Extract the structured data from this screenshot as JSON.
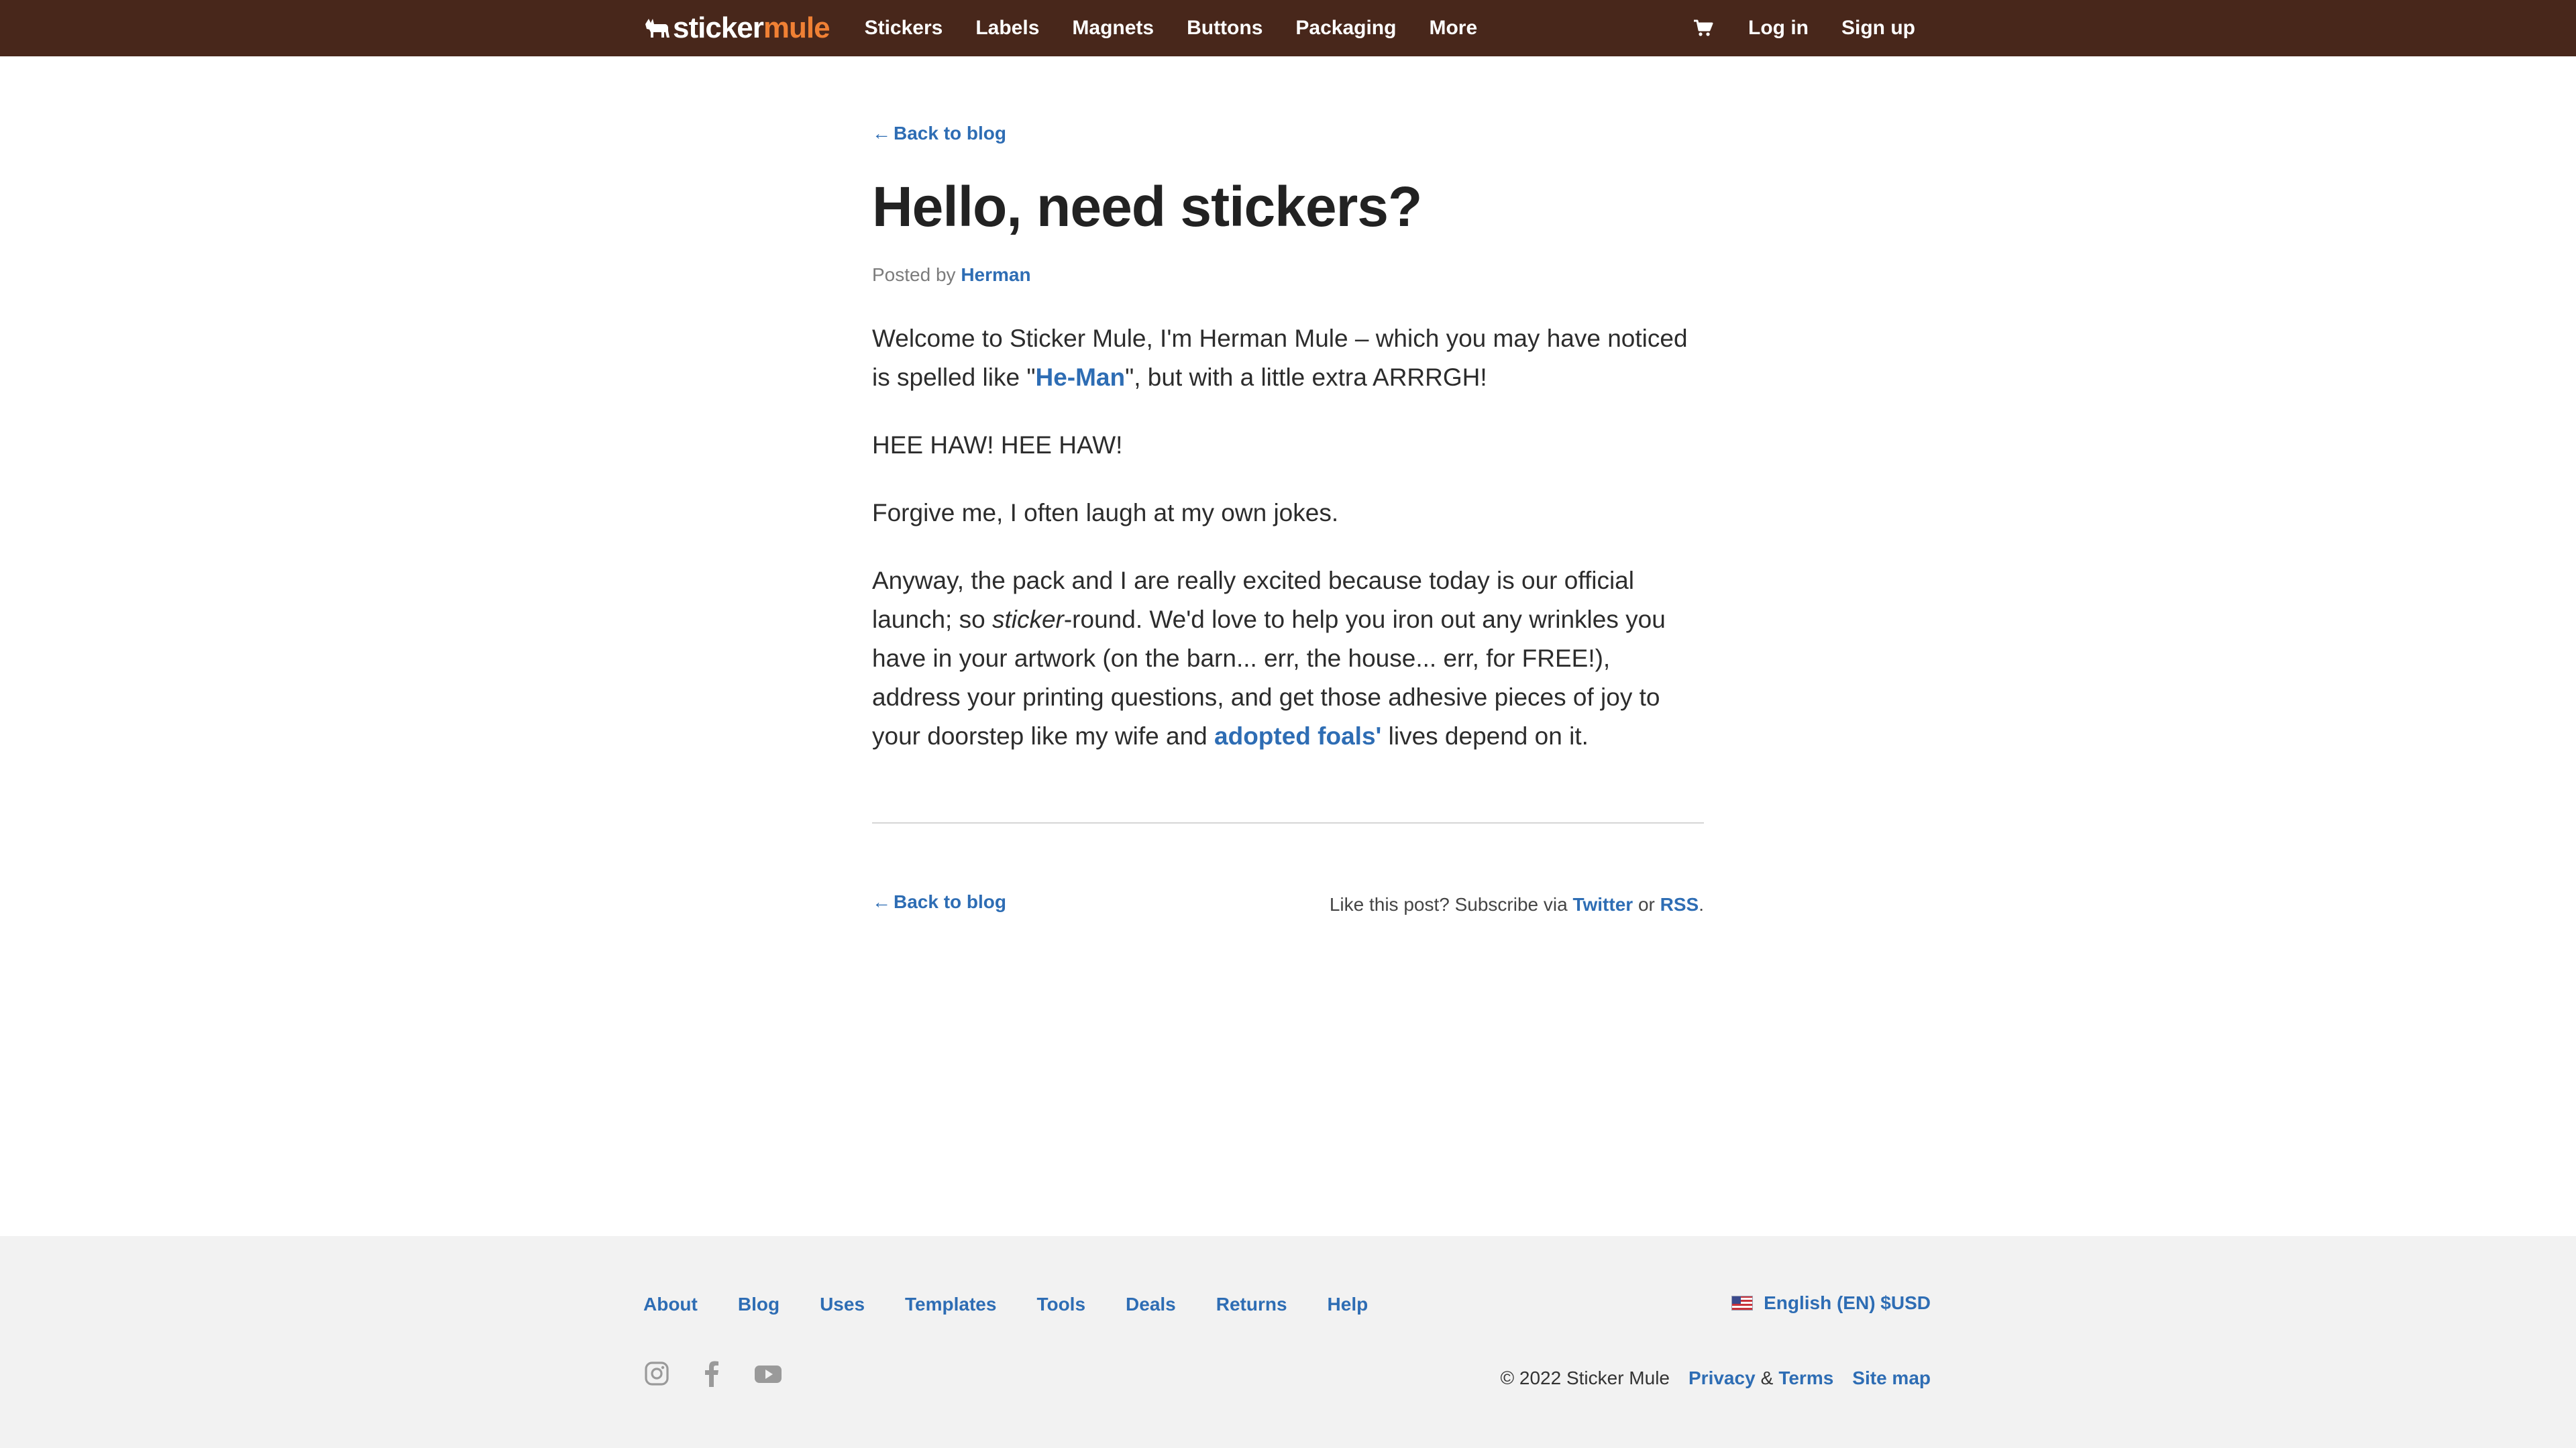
{
  "header": {
    "logo": {
      "word1": "sticker",
      "word2": "mule",
      "icon": "mule-icon"
    },
    "nav": [
      "Stickers",
      "Labels",
      "Magnets",
      "Buttons",
      "Packaging",
      "More"
    ],
    "cart_icon": "cart-icon",
    "login": "Log in",
    "signup": "Sign up"
  },
  "article": {
    "back_arrow": "←",
    "back_label": "Back to blog",
    "title": "Hello, need stickers?",
    "byline_prefix": "Posted by",
    "author": "Herman",
    "p1_a": "Welcome to Sticker Mule, I'm Herman Mule – which you may have noticed is spelled like \"",
    "p1_link": "He-Man",
    "p1_b": "\", but with a little extra ARRRGH!",
    "p2": "HEE HAW! HEE HAW!",
    "p3": "Forgive me, I often laugh at my own jokes.",
    "p4_a": "Anyway, the pack and I are really excited because today is our official launch; so ",
    "p4_em": "sticker",
    "p4_b": "-round. We'd love to help you iron out any wrinkles you have in your artwork (on the barn... err, the house... err, for FREE!), address your printing questions, and get those adhesive pieces of joy to your doorstep like my wife and ",
    "p4_link": "adopted foals'",
    "p4_c": " lives depend on it.",
    "subscribe_prefix": "Like this post? Subscribe via",
    "subscribe_twitter": "Twitter",
    "subscribe_or": "or",
    "subscribe_rss": "RSS",
    "subscribe_end": "."
  },
  "footer": {
    "links": [
      "About",
      "Blog",
      "Uses",
      "Templates",
      "Tools",
      "Deals",
      "Returns",
      "Help"
    ],
    "language": "English (EN) $USD",
    "flag_icon": "us-flag-icon",
    "social_icons": [
      "instagram-icon",
      "facebook-icon",
      "youtube-icon"
    ],
    "copyright": "© 2022 Sticker Mule",
    "privacy": "Privacy",
    "amp": "&",
    "terms": "Terms",
    "sitemap": "Site map"
  },
  "colors": {
    "header_bg": "#48271b",
    "brand_orange": "#f08034",
    "link_blue": "#2e6db4",
    "footer_bg": "#f2f2f2"
  }
}
